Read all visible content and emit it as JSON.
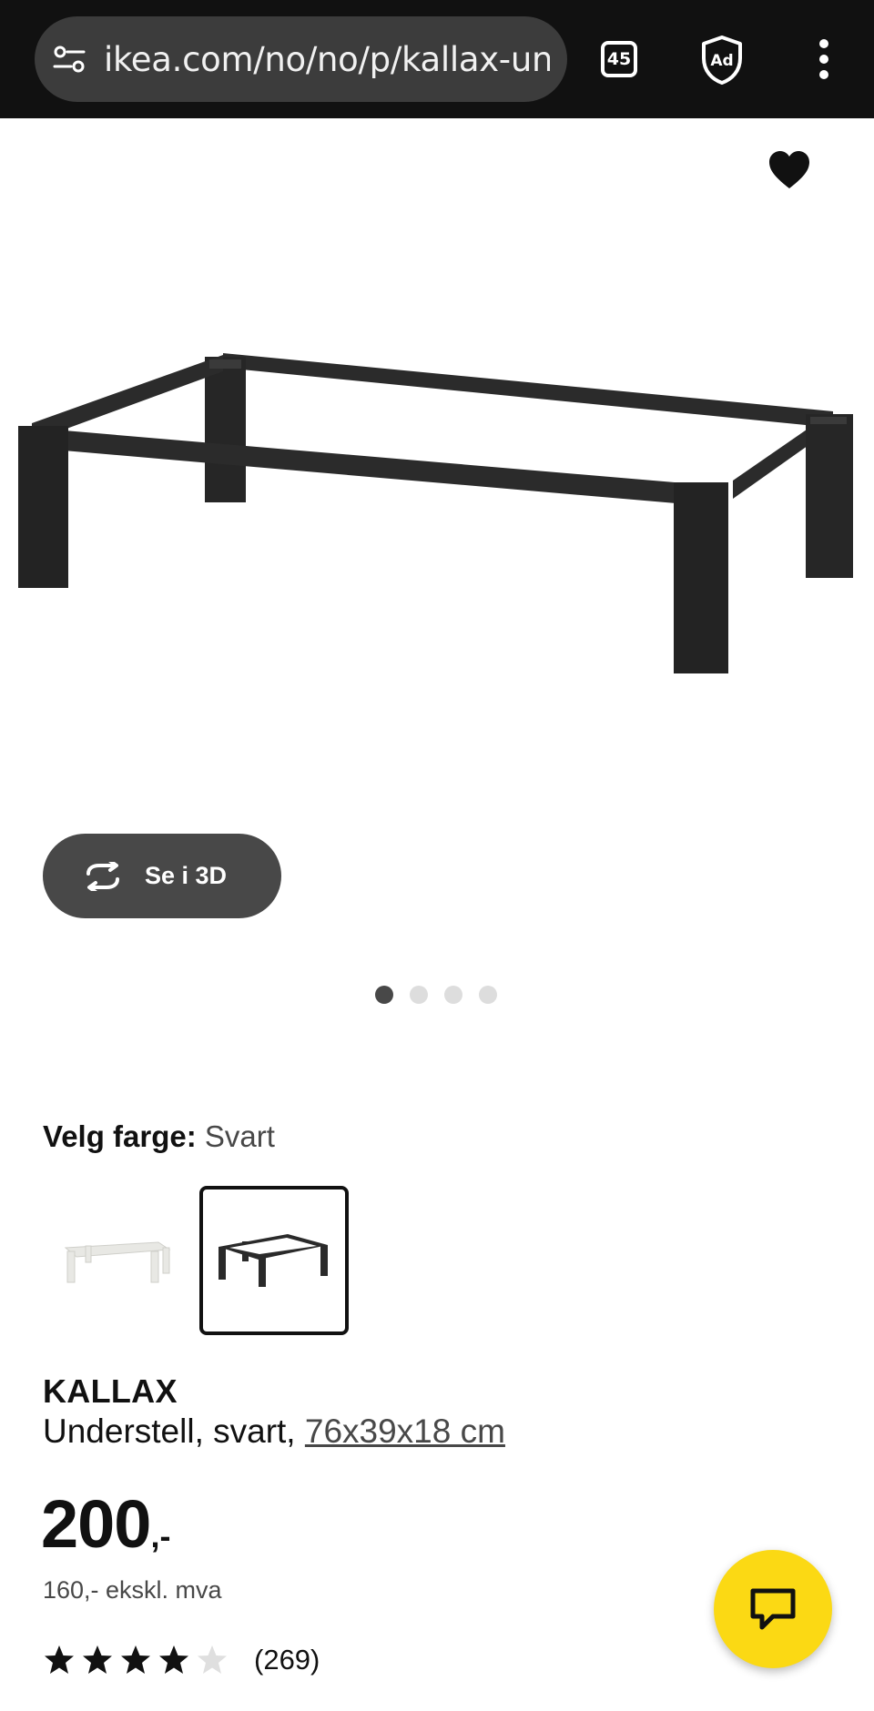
{
  "browser": {
    "url": "ikea.com/no/no/p/kallax-unders",
    "tab_count": "45",
    "icons": [
      "tune-icon",
      "tabs-icon",
      "adblock-shield-icon",
      "more-vert-icon"
    ]
  },
  "gallery": {
    "see_3d_label": "Se i 3D",
    "page_count": 4,
    "active_page": 1
  },
  "color": {
    "label": "Velg farge:",
    "selected": "Svart"
  },
  "product": {
    "name": "KALLAX",
    "description": "Understell, svart, ",
    "size_link": "76x39x18 cm",
    "price_integer": "200",
    "price_suffix": ",-",
    "price_ex_vat": "160,- ekskl. mva",
    "rating_value": 4,
    "rating_max": 5,
    "review_count": "(269)"
  },
  "colors": {
    "topbar": "#111111",
    "chat_button": "#fbd914",
    "see_3d_button": "#484848"
  }
}
